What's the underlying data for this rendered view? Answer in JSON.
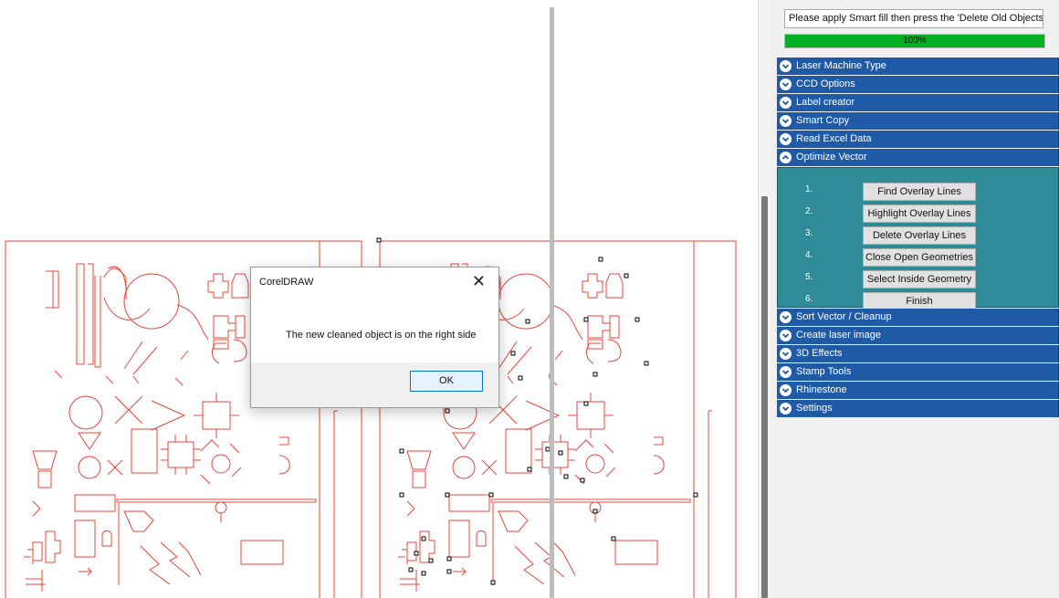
{
  "docker": {
    "status_text": "Please apply Smart fill then press the 'Delete Old Objects'",
    "progress_label": "100%",
    "progress_value": 1.0,
    "sections": [
      {
        "label": "Laser Machine Type",
        "expanded": false
      },
      {
        "label": "CCD Options",
        "expanded": false
      },
      {
        "label": "Label creator",
        "expanded": false
      },
      {
        "label": "Smart Copy",
        "expanded": false
      },
      {
        "label": "Read Excel Data",
        "expanded": false
      },
      {
        "label": "Optimize Vector",
        "expanded": true
      },
      {
        "label": "Sort Vector / Cleanup",
        "expanded": false
      },
      {
        "label": "Create laser image",
        "expanded": false
      },
      {
        "label": "3D Effects",
        "expanded": false
      },
      {
        "label": "Stamp Tools",
        "expanded": false
      },
      {
        "label": "Rhinestone",
        "expanded": false
      },
      {
        "label": "Settings",
        "expanded": false
      }
    ],
    "optimize_steps": [
      {
        "num": "1.",
        "label": "Find Overlay Lines"
      },
      {
        "num": "2.",
        "label": "Highlight Overlay Lines"
      },
      {
        "num": "3.",
        "label": "Delete Overlay Lines"
      },
      {
        "num": "4.",
        "label": "Close Open Geometries"
      },
      {
        "num": "5.",
        "label": "Select Inside Geometry"
      },
      {
        "num": "6.",
        "label": "Finish"
      }
    ]
  },
  "dialog": {
    "title": "CorelDRAW",
    "message": "The new cleaned object is on the right side",
    "ok_label": "OK",
    "close_glyph": "✕"
  },
  "colors": {
    "header": "#1e5aa5",
    "panel_body": "#2e8b98",
    "artwork_stroke": "#e8443a",
    "progress": "#06b025"
  },
  "icons": {
    "section_collapsed": "chevron-down-circle-icon",
    "section_expanded": "chevron-up-circle-icon",
    "dialog_close": "close-icon"
  }
}
